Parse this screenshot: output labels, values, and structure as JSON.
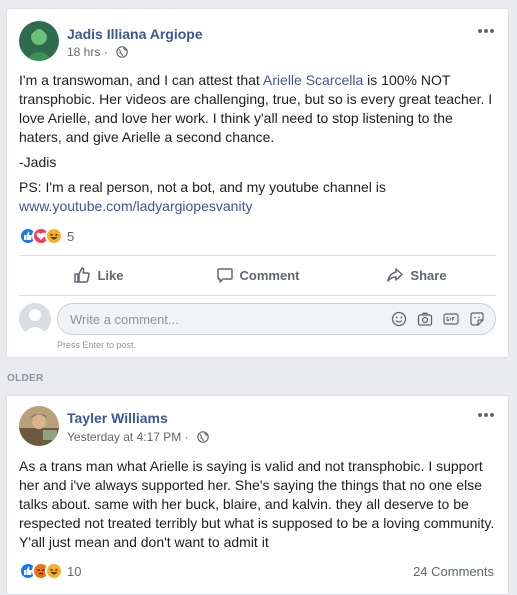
{
  "posts": [
    {
      "author": "Jadis Illiana Argiope",
      "time": "18 hrs",
      "body_intro": "I'm a transwoman, and I can attest that ",
      "mention": "Arielle Scarcella",
      "body_rest": " is 100% NOT transphobic. Her videos are challenging, true, but so is every great teacher. I love Arielle, and love her work. I think y'all need to stop listening to the haters, and give Arielle a second chance.",
      "signoff": "-Jadis",
      "ps": "PS: I'm a real person, not a bot, and my youtube channel is",
      "link": "www.youtube.com/ladyargiopesvanity",
      "reaction_count": "5",
      "reactions": [
        "like-icon",
        "love-icon",
        "haha-icon"
      ],
      "actions": {
        "like": "Like",
        "comment": "Comment",
        "share": "Share"
      },
      "comment_placeholder": "Write a comment...",
      "enter_hint": "Press Enter to post."
    },
    {
      "author": "Tayler Williams",
      "time": "Yesterday at 4:17 PM",
      "body": "As a trans man what Arielle is saying is valid and not transphobic. I support her and i've always supported her. She's saying the things that no one else talks about. same with her buck, blaire, and kalvin. they all deserve to be respected not treated terribly but what is supposed to be a loving community. Y'all just mean and don't want to admit it",
      "reaction_count": "10",
      "reactions": [
        "like-icon",
        "angry-icon",
        "haha-icon"
      ],
      "comments_count": "24 Comments"
    }
  ],
  "section_label": "OLDER",
  "separator": " · ",
  "colors": {
    "link": "#385898",
    "like": "#1877f2",
    "love": "#f33e58",
    "haha": "#f7b125",
    "angry": "#e9710f"
  }
}
